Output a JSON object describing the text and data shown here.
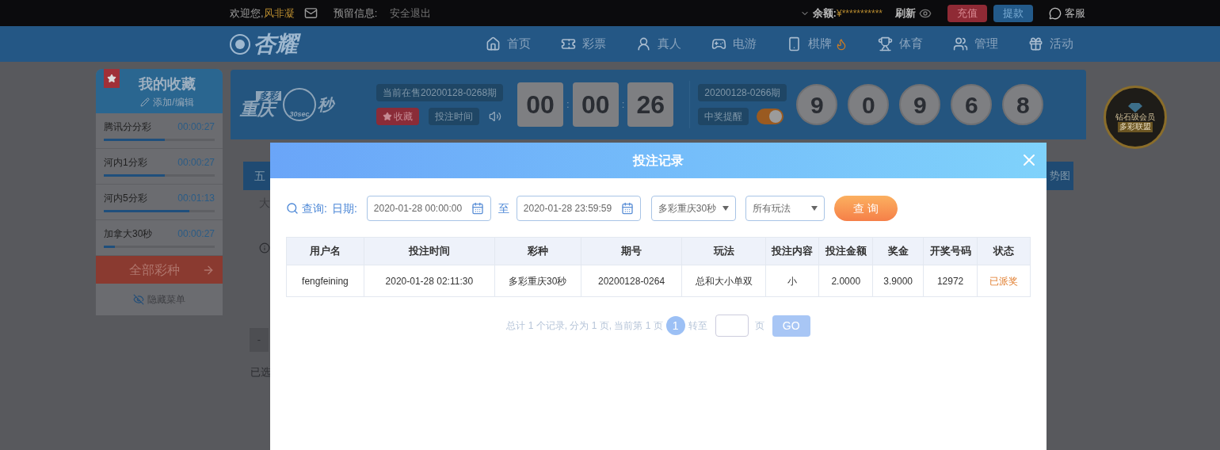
{
  "top_bar": {
    "greeting": "欢迎您,",
    "username": "风非凝",
    "reserved_label": "预留信息:",
    "logout": "安全退出",
    "balance_label": "余额:",
    "balance": "¥***********",
    "refresh": "刷新",
    "recharge": "充值",
    "withdraw": "提款",
    "service": "客服"
  },
  "nav": {
    "logo": "杏耀",
    "items": [
      {
        "label": "首页"
      },
      {
        "label": "彩票"
      },
      {
        "label": "真人"
      },
      {
        "label": "电游"
      },
      {
        "label": "棋牌"
      },
      {
        "label": "体育"
      },
      {
        "label": "管理"
      },
      {
        "label": "活动"
      }
    ]
  },
  "favorites": {
    "title": "我的收藏",
    "edit": "添加/编辑",
    "items": [
      {
        "name": "腾讯分分彩",
        "time": "00:00:27",
        "level": 0.55
      },
      {
        "name": "河内1分彩",
        "time": "00:00:27",
        "level": 0.55
      },
      {
        "name": "河内5分彩",
        "time": "00:01:13",
        "level": 0.77
      },
      {
        "name": "加拿大30秒",
        "time": "00:00:27",
        "level": 0.1
      }
    ],
    "all": "全部彩种",
    "hide": "隐藏菜单"
  },
  "banner": {
    "logo_tag": "多彩",
    "logo_city": "重庆",
    "logo_sec": "30sec",
    "logo_suffix": "秒",
    "current_issue": "当前在售20200128-0268期",
    "favorite": "收藏",
    "bet_time": "投注时间",
    "countdown": [
      "00",
      "00",
      "26"
    ],
    "separator": ":",
    "last_issue": "20200128-0266期",
    "alert": "中奖提醒",
    "alert_on": true,
    "balls": [
      "9",
      "0",
      "9",
      "6",
      "8"
    ]
  },
  "badge": {
    "title": "钻石级会员",
    "subtitle": "多彩联盟"
  },
  "background_fragments": {
    "tab": "五",
    "option": "大",
    "trend": "势图",
    "minus": "-",
    "selected": "已选"
  },
  "modal": {
    "title": "投注记录",
    "query_label": "查询:",
    "date_label": "日期:",
    "from": "2020-01-28 00:00:00",
    "range_sep": "至",
    "to": "2020-01-28 23:59:59",
    "lottery": "多彩重庆30秒",
    "play": "所有玩法",
    "search": "查 询",
    "columns": [
      "用户名",
      "投注时间",
      "彩种",
      "期号",
      "玩法",
      "投注内容",
      "投注金额",
      "奖金",
      "开奖号码",
      "状态"
    ],
    "rows": [
      {
        "cells": [
          "fengfeining",
          "2020-01-28 02:11:30",
          "多彩重庆30秒",
          "20200128-0264",
          "总和大小单双",
          "小",
          "2.0000",
          "3.9000",
          "12972",
          "已派奖"
        ]
      }
    ],
    "pagination": {
      "summary": "总计 1 个记录, 分为 1 页, 当前第 1 页",
      "current": "1",
      "goto": "转至",
      "suffix": "页",
      "go": "GO"
    }
  }
}
